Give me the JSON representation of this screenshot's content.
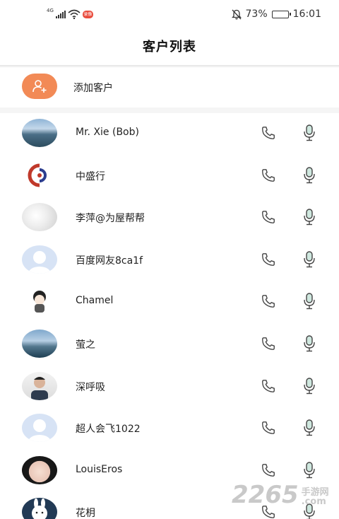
{
  "status_bar": {
    "network": "4G",
    "record_badge": "录像",
    "battery_percent": "73%",
    "battery_level": 0.73,
    "time": "16:01"
  },
  "header": {
    "title": "客户列表"
  },
  "add_customer": {
    "label": "添加客户",
    "icon": "add-user-icon",
    "icon_color": "#f28a56"
  },
  "customers": [
    {
      "name": "Mr. Xie (Bob)",
      "avatar": "landscape-photo"
    },
    {
      "name": "中盛行",
      "avatar": "company-logo"
    },
    {
      "name": "李萍@为屋帮帮",
      "avatar": "blurred-photo"
    },
    {
      "name": "百度网友8ca1f",
      "avatar": "default-avatar"
    },
    {
      "name": "Chamel⁨",
      "avatar": "cartoon-avatar"
    },
    {
      "name": "萤之",
      "avatar": "sea-photo"
    },
    {
      "name": "深呼吸",
      "avatar": "person-photo"
    },
    {
      "name": "超人会飞1022",
      "avatar": "default-avatar"
    },
    {
      "name": "LouisEros",
      "avatar": "girl-photo"
    },
    {
      "name": "花枂",
      "avatar": "bunny-avatar"
    }
  ],
  "icons": {
    "call": "phone-icon",
    "voice": "microphone-icon"
  },
  "watermark": {
    "number": "2265",
    "site": "手游网",
    "domain": ".com"
  }
}
